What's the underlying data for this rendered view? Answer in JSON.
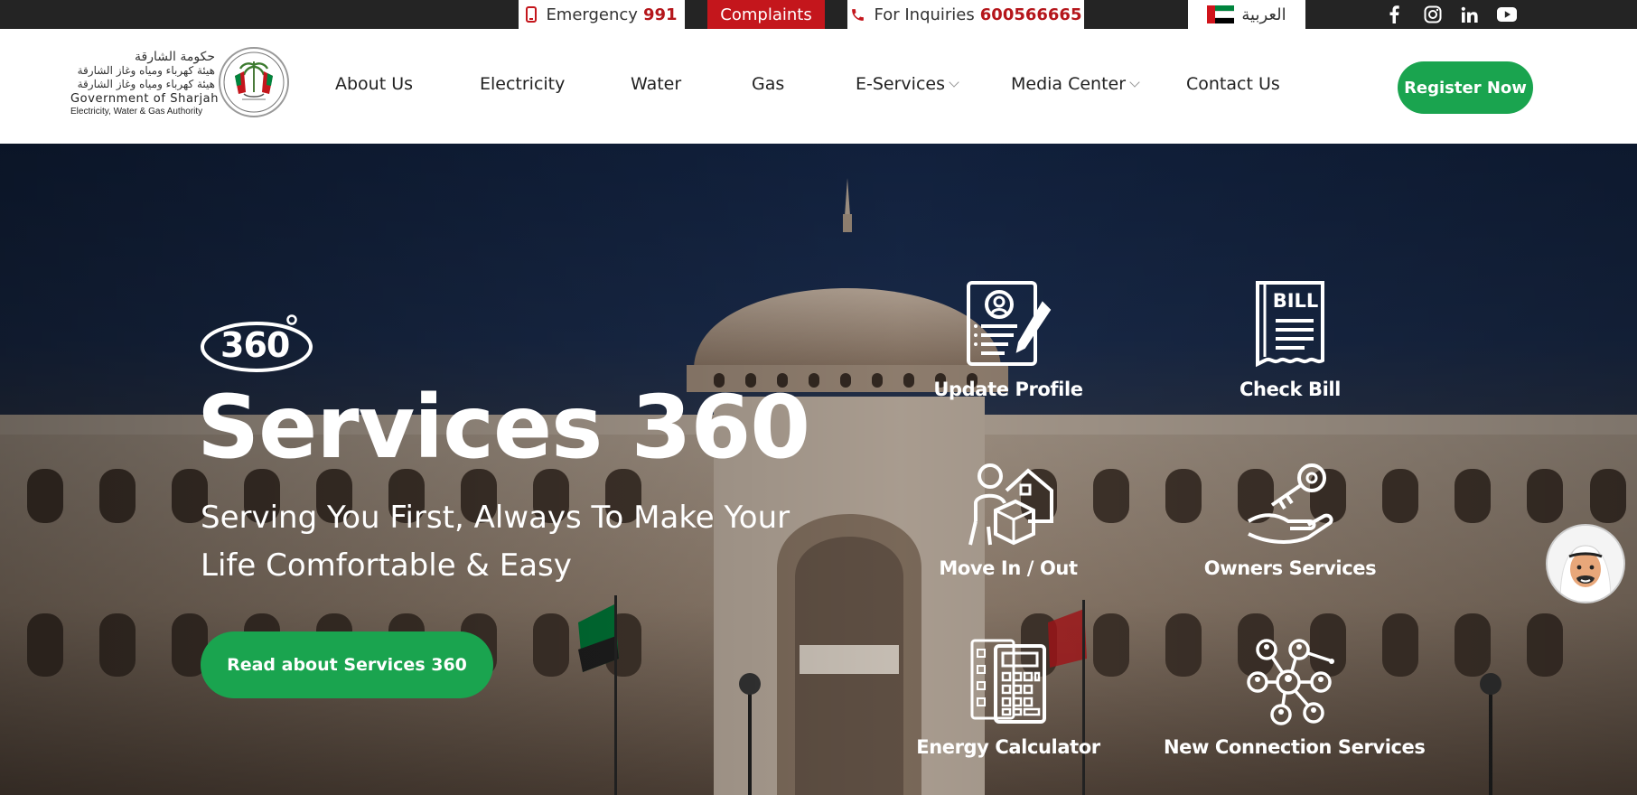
{
  "topbar": {
    "emergency_label": "Emergency",
    "emergency_number": "991",
    "complaints_label": "Complaints",
    "inquiries_label": "For Inquiries",
    "inquiries_number": "600566665",
    "language_label": "العربية",
    "social": [
      "facebook-icon",
      "instagram-icon",
      "linkedin-icon",
      "youtube-icon"
    ]
  },
  "logo": {
    "arabic_line1": "حكومة الشارقة",
    "arabic_line2": "هيئة كهرباء ومياه وغاز الشارقة",
    "arabic_line3": "هيئة كهرباء ومياه وغاز الشارقة",
    "english_line1": "Government of Sharjah",
    "english_line2": "Electricity, Water & Gas Authority"
  },
  "nav": {
    "items": [
      {
        "label": "About Us",
        "dropdown": false
      },
      {
        "label": "Electricity",
        "dropdown": false
      },
      {
        "label": "Water",
        "dropdown": false
      },
      {
        "label": "Gas",
        "dropdown": false
      },
      {
        "label": "E-Services",
        "dropdown": true
      },
      {
        "label": "Media Center",
        "dropdown": true
      },
      {
        "label": "Contact Us",
        "dropdown": false
      }
    ],
    "register_label": "Register Now"
  },
  "hero": {
    "badge": "360",
    "title": "Services 360",
    "subtitle": "Serving You First, Always To Make Your Life Comfortable & Easy",
    "button_label": "Read about Services 360"
  },
  "services": [
    {
      "label": "Update Profile",
      "icon": "profile-edit-icon"
    },
    {
      "label": "Check Bill",
      "icon": "bill-icon"
    },
    {
      "label": "Move In / Out",
      "icon": "move-house-icon"
    },
    {
      "label": "Owners Services",
      "icon": "key-hand-icon"
    },
    {
      "label": "Energy Calculator",
      "icon": "calculator-icon"
    },
    {
      "label": "New Connection Services",
      "icon": "network-people-icon"
    }
  ],
  "bill_icon_text": "BILL",
  "colors": {
    "topbar_bg": "#242424",
    "accent_red": "#c4161c",
    "accent_green": "#1aa44f",
    "hero_sky": "#142647"
  }
}
